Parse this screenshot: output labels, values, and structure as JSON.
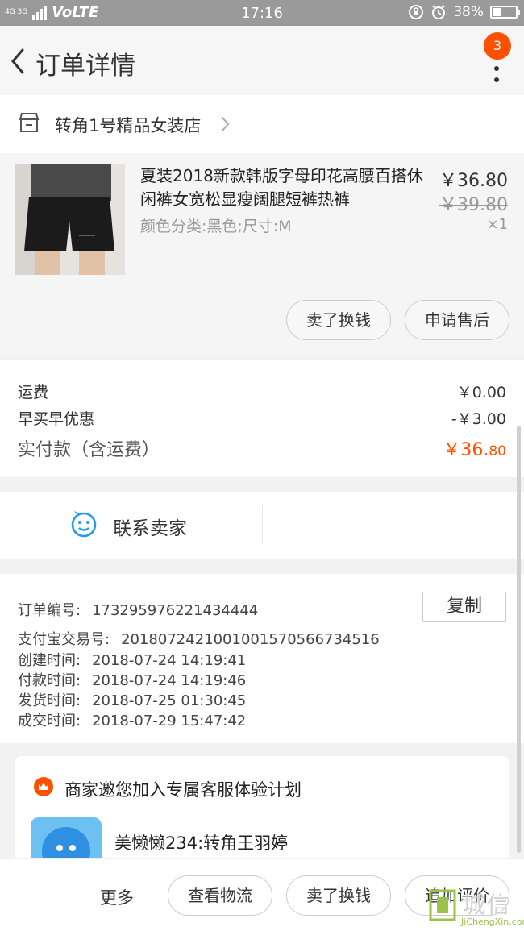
{
  "status_bar": {
    "network_small": "4G 3G",
    "volte": "VoLTE",
    "time": "17:16",
    "battery": "38%",
    "battery_level": 0.38
  },
  "nav": {
    "title": "订单详情",
    "badge": "3"
  },
  "shop": {
    "name": "转角1号精品女装店"
  },
  "goods": {
    "name": "夏装2018新款韩版字母印花高腰百搭休闲裤女宽松显瘦阔腿短裤热裤",
    "sku": "颜色分类:黑色;尺寸:M",
    "price": "￥36.80",
    "original_price": "￥39.80",
    "quantity": "×1",
    "btn_sell": "卖了换钱",
    "btn_aftersale": "申请售后"
  },
  "fees": {
    "shipping_label": "运费",
    "shipping_value": "￥0.00",
    "discount_label": "早买早优惠",
    "discount_value": "-￥3.00",
    "total_label": "实付款（含运费）",
    "total_value_main": "￥36.",
    "total_value_cents": "80"
  },
  "contact": {
    "label": "联系卖家"
  },
  "order_info": {
    "copy_label": "复制",
    "rows": [
      {
        "key": "订单编号:",
        "value": "173295976221434444"
      },
      {
        "key": "支付宝交易号:",
        "value": "2018072421001001570566734516"
      },
      {
        "key": "创建时间:",
        "value": "2018-07-24  14:19:41"
      },
      {
        "key": "付款时间:",
        "value": "2018-07-24  14:19:46"
      },
      {
        "key": "发货时间:",
        "value": "2018-07-25  01:30:45"
      },
      {
        "key": "成交时间:",
        "value": "2018-07-29  15:47:42"
      }
    ]
  },
  "invite": {
    "title": "商家邀您加入专属客服体验计划",
    "cs_name": "美懒懒234:转角王羽婷"
  },
  "bottom_bar": {
    "more": "更多",
    "logistics": "查看物流",
    "sell": "卖了换钱",
    "review": "追加评价"
  },
  "watermark": {
    "cn": "城信",
    "en": "JiChengXin.com"
  },
  "colors": {
    "accent": "#ff5000",
    "status_bar": "#9a9a9a",
    "contact_icon": "#1e9cf0"
  }
}
